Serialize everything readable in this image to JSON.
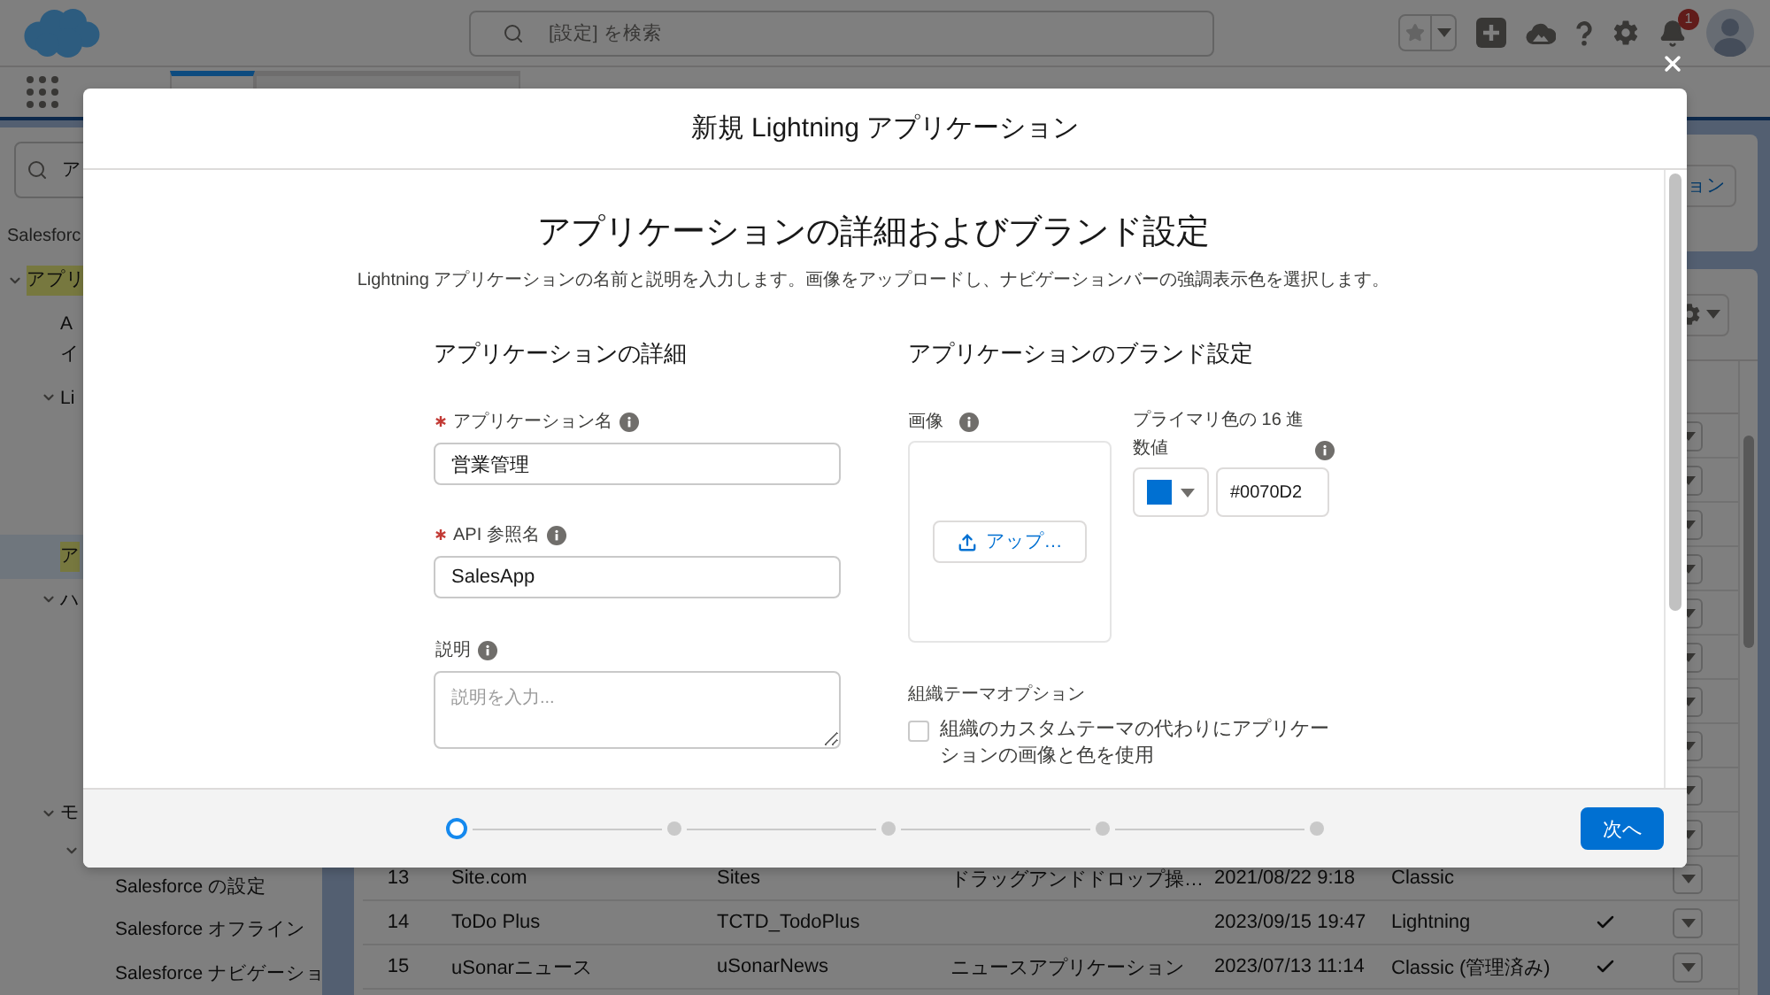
{
  "top_bar": {
    "search": {
      "placeholder": "[設定] を検索"
    },
    "notification_count": "1"
  },
  "nav_tabs": [
    {
      "selected": true
    },
    {
      "selected": false
    }
  ],
  "sidebar": {
    "search": {
      "value": "ア"
    },
    "section": "Salesforc",
    "tree": [
      {
        "label": "アプリ",
        "expanded": true,
        "selected": false,
        "highlighted": true,
        "children": [
          {
            "lines": [
              "A",
              "イ"
            ],
            "selected": false,
            "highlighted": false
          },
          {
            "label": "Li",
            "expanded": true,
            "selected": false,
            "highlighted": false
          },
          {
            "label": "ア",
            "selected": true,
            "highlighted": true
          },
          {
            "label": "ハ",
            "expanded": true,
            "selected": false,
            "highlighted": false
          },
          {
            "label": "モ",
            "expanded": true,
            "selected": false,
            "highlighted": false,
            "children": [
              {
                "expanded": true,
                "selected": false,
                "children": [
                  {
                    "label": "Salesforce の設定",
                    "selected": false,
                    "highlighted": false
                  },
                  {
                    "label": "Salesforce オフライン",
                    "selected": false,
                    "highlighted": false
                  },
                  {
                    "label": "Salesforce ナビゲーショ",
                    "selected": false,
                    "highlighted": false
                  }
                ]
              }
            ]
          }
        ]
      }
    ]
  },
  "page_header": {
    "button": "ョン"
  },
  "table": {
    "rows": [
      {
        "cells": [
          "13",
          "Site.com",
          "Sites",
          "ドラッグアンドドロップ操…",
          "2021/08/22 9:18",
          "Classic"
        ],
        "checked": false
      },
      {
        "cells": [
          "14",
          "ToDo Plus",
          "TCTD_TodoPlus",
          null,
          "2023/09/15 19:47",
          "Lightning"
        ],
        "checked": true
      },
      {
        "cells": [
          "15",
          "uSonarニュース",
          "uSonarNews",
          "ニュースアプリケーション",
          "2023/07/13 11:14",
          "Classic (管理済み)"
        ],
        "checked": true
      }
    ]
  },
  "modal": {
    "title": "新規 Lightning アプリケーション",
    "heading": "アプリケーションの詳細およびブランド設定",
    "description": "Lightning アプリケーションの名前と説明を入力します。画像をアップロードし、ナビゲーションバーの強調表示色を選択します。",
    "details": {
      "title": "アプリケーションの詳細",
      "fields": [
        {
          "kind": "input",
          "label": "アプリケーション名",
          "required": true,
          "value": "営業管理"
        },
        {
          "kind": "input",
          "label": "API 参照名",
          "required": true,
          "value": "SalesApp"
        },
        {
          "kind": "textarea",
          "label": "説明",
          "required": false,
          "placeholder": "説明を入力..."
        }
      ]
    },
    "branding": {
      "title": "アプリケーションのブランド設定",
      "image": {
        "label": "画像",
        "button": "アップ…"
      },
      "primary_color": {
        "label": "プライマリ色の 16 進数値",
        "color": "#0070d2",
        "value": "#0070D2"
      },
      "theme": {
        "title": "組織テーマオプション",
        "option": {
          "label": "組織のカスタムテーマの代わりにアプリケーションの画像と色を使用",
          "checked": false
        }
      }
    },
    "steps": [
      {
        "selected": true
      },
      {
        "selected": false
      },
      {
        "selected": false
      },
      {
        "selected": false
      },
      {
        "selected": false
      }
    ],
    "next_button": "次へ"
  }
}
